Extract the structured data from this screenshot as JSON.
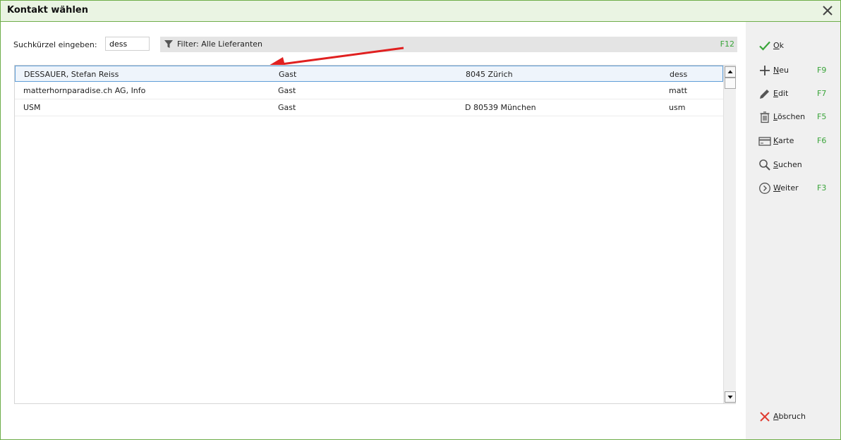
{
  "window": {
    "title": "Kontakt wählen"
  },
  "search": {
    "label": "Suchkürzel eingeben:",
    "value": "dess"
  },
  "filter": {
    "label": "Filter: Alle Lieferanten",
    "shortcut": "F12"
  },
  "table": {
    "rows": [
      {
        "name": "DESSAUER, Stefan Reiss",
        "type": "Gast",
        "location": "8045 Zürich",
        "code": "dess",
        "selected": true
      },
      {
        "name": "matterhornparadise.ch AG, Info",
        "type": "Gast",
        "location": "",
        "code": "matt",
        "selected": false
      },
      {
        "name": "USM",
        "type": "Gast",
        "location": "D 80539 München",
        "code": "usm",
        "selected": false
      }
    ]
  },
  "actions": {
    "ok": {
      "label": "Ok",
      "icon": "check-icon"
    },
    "neu": {
      "label": "Neu",
      "key": "F9",
      "icon": "plus-icon"
    },
    "edit": {
      "label": "Edit",
      "key": "F7",
      "icon": "pencil-icon"
    },
    "loeschen": {
      "label": "Löschen",
      "key": "F5",
      "icon": "trash-icon"
    },
    "karte": {
      "label": "Karte",
      "key": "F6",
      "icon": "card-icon"
    },
    "suchen": {
      "label": "Suchen",
      "icon": "search-icon"
    },
    "weiter": {
      "label": "Weiter",
      "key": "F3",
      "icon": "chevron-circle-right-icon"
    },
    "abbruch": {
      "label": "Abbruch",
      "icon": "x-icon"
    }
  },
  "colors": {
    "accent_green": "#6fae4a",
    "shortcut_green": "#3aa53a",
    "cancel_red": "#e03c31",
    "selection_border": "#5f9ed8",
    "annotation_arrow": "#e02020"
  }
}
